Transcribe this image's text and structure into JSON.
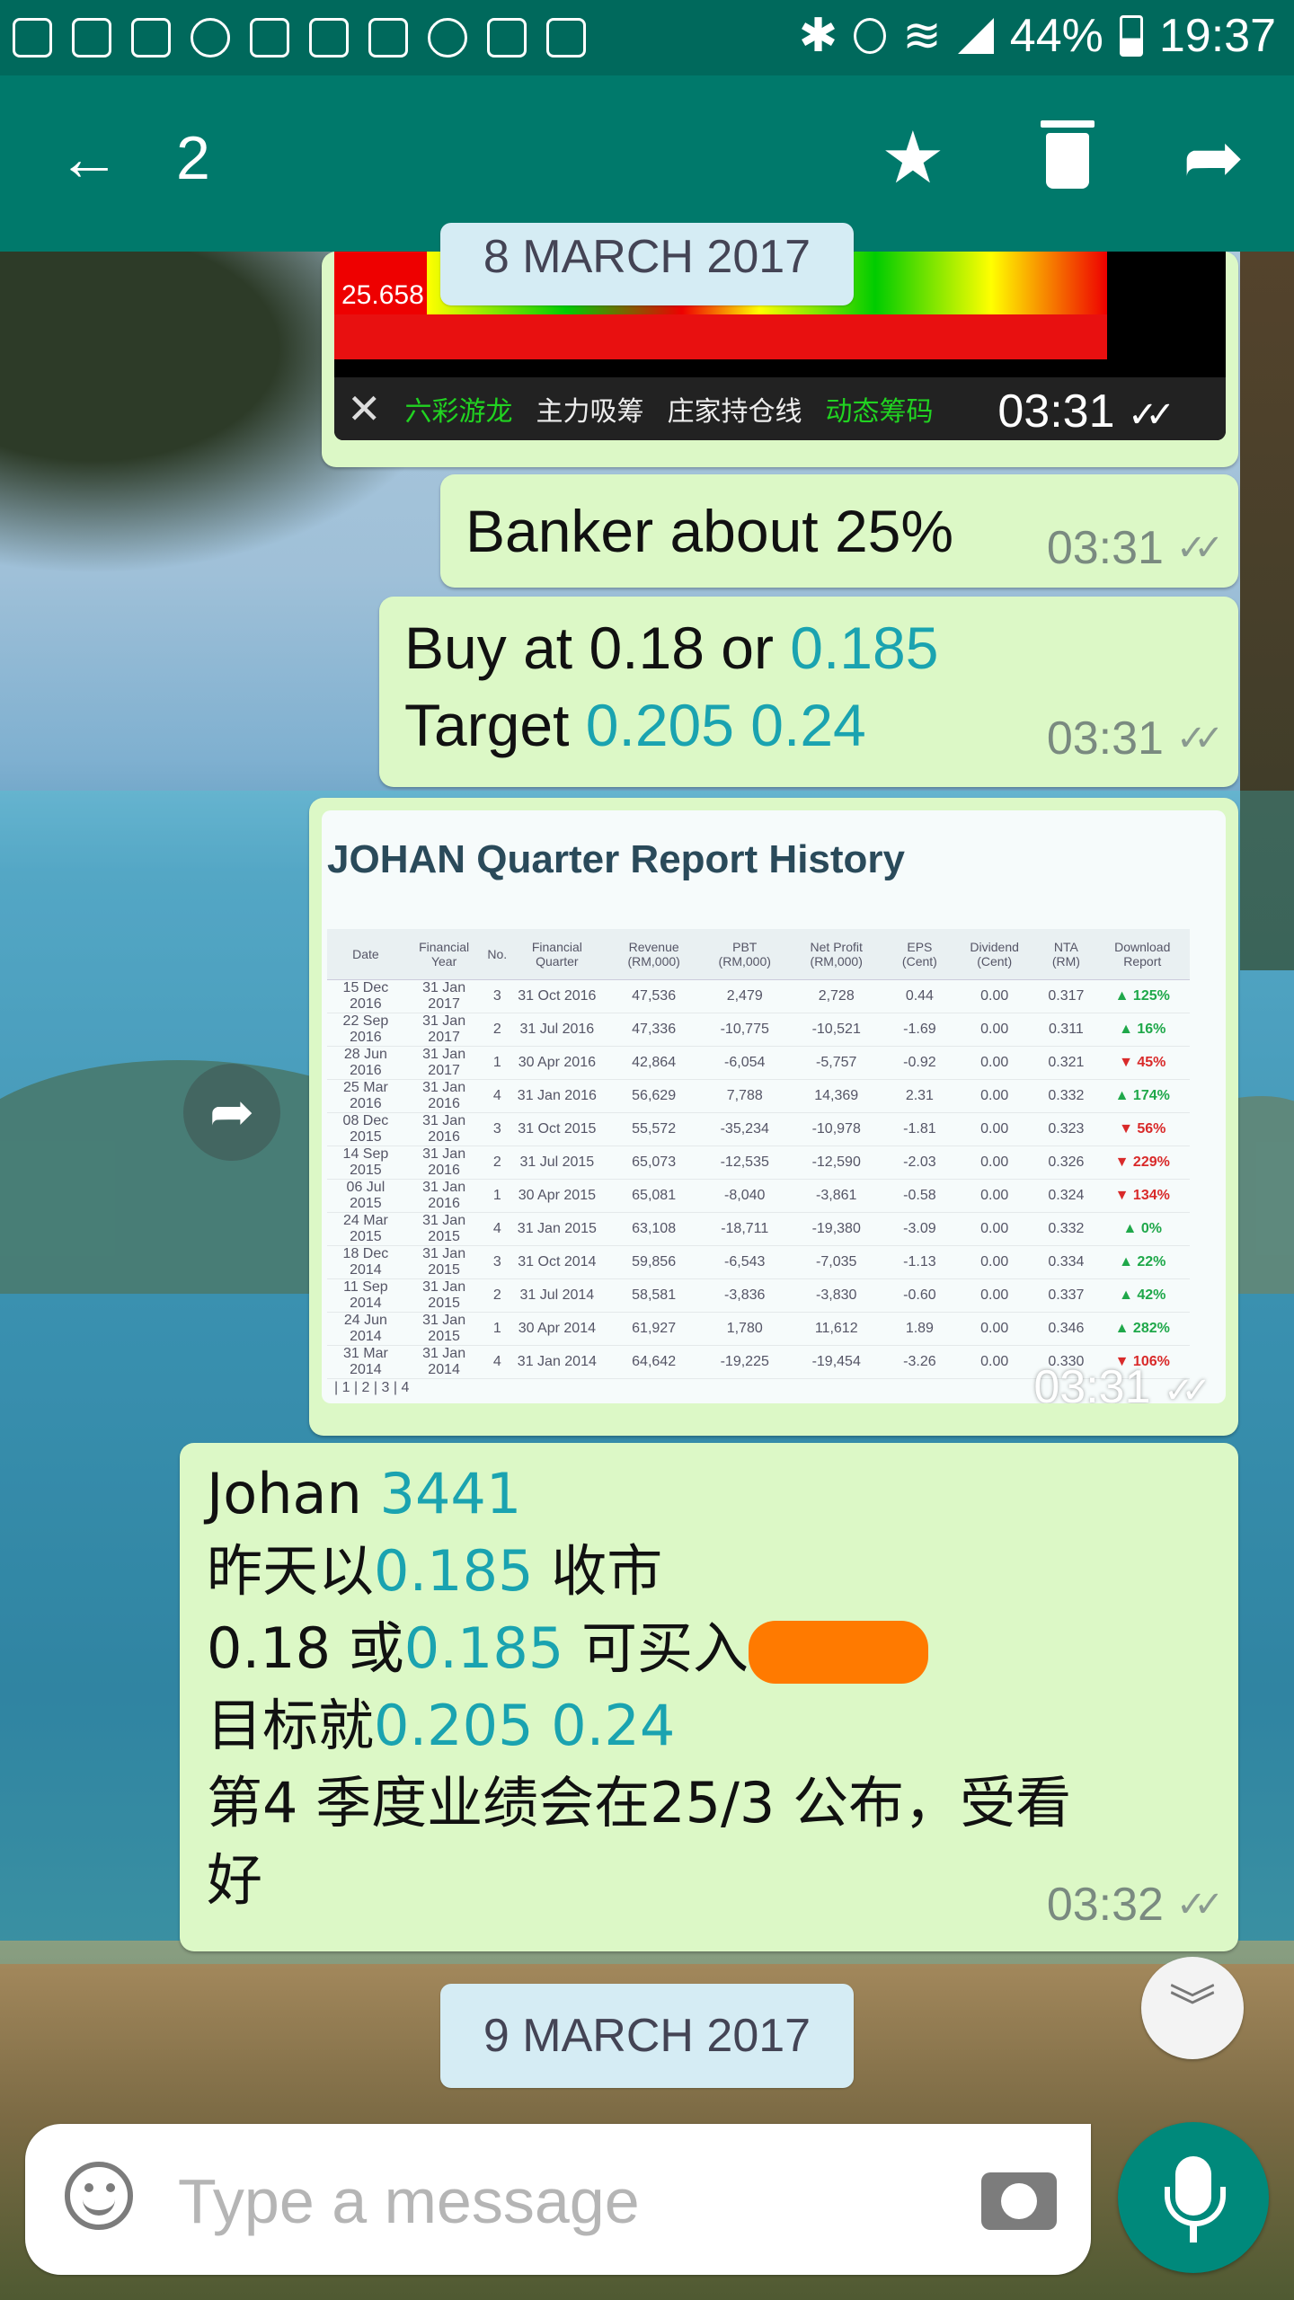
{
  "status_bar": {
    "battery": "44%",
    "time": "19:37"
  },
  "app_bar": {
    "selected_count": "2"
  },
  "chart_message": {
    "date_overlay": "8 MARCH 2017",
    "value": "25.658",
    "toolbar_items": [
      "六彩游龙",
      "主力吸筹",
      "庄家持仓线",
      "动态筹码"
    ],
    "time": "03:31"
  },
  "msg_banker": {
    "text": "Banker about 25%",
    "time": "03:31"
  },
  "msg_buy": {
    "line1_prefix": "Buy at 0.18 or ",
    "line1_value": "0.185",
    "line2_prefix": "Target ",
    "line2_value": "0.205 0.24",
    "time": "03:31"
  },
  "report_image": {
    "title": "JOHAN Quarter Report History",
    "columns": [
      "Date",
      "Financial Year",
      "No.",
      "Financial Quarter",
      "Revenue (RM,000)",
      "PBT (RM,000)",
      "Net Profit (RM,000)",
      "EPS (Cent)",
      "Dividend (Cent)",
      "NTA (RM)",
      "Download Report"
    ],
    "rows": [
      [
        "15 Dec 2016",
        "31 Jan 2017",
        "3",
        "31 Oct 2016",
        "47,536",
        "2,479",
        "2,728",
        "0.44",
        "0.00",
        "0.317",
        "125%",
        "up"
      ],
      [
        "22 Sep 2016",
        "31 Jan 2017",
        "2",
        "31 Jul 2016",
        "47,336",
        "-10,775",
        "-10,521",
        "-1.69",
        "0.00",
        "0.311",
        "16%",
        "up"
      ],
      [
        "28 Jun 2016",
        "31 Jan 2017",
        "1",
        "30 Apr 2016",
        "42,864",
        "-6,054",
        "-5,757",
        "-0.92",
        "0.00",
        "0.321",
        "45%",
        "down"
      ],
      [
        "25 Mar 2016",
        "31 Jan 2016",
        "4",
        "31 Jan 2016",
        "56,629",
        "7,788",
        "14,369",
        "2.31",
        "0.00",
        "0.332",
        "174%",
        "up"
      ],
      [
        "08 Dec 2015",
        "31 Jan 2016",
        "3",
        "31 Oct 2015",
        "55,572",
        "-35,234",
        "-10,978",
        "-1.81",
        "0.00",
        "0.323",
        "56%",
        "down"
      ],
      [
        "14 Sep 2015",
        "31 Jan 2016",
        "2",
        "31 Jul 2015",
        "65,073",
        "-12,535",
        "-12,590",
        "-2.03",
        "0.00",
        "0.326",
        "229%",
        "down"
      ],
      [
        "06 Jul 2015",
        "31 Jan 2016",
        "1",
        "30 Apr 2015",
        "65,081",
        "-8,040",
        "-3,861",
        "-0.58",
        "0.00",
        "0.324",
        "134%",
        "down"
      ],
      [
        "24 Mar 2015",
        "31 Jan 2015",
        "4",
        "31 Jan 2015",
        "63,108",
        "-18,711",
        "-19,380",
        "-3.09",
        "0.00",
        "0.332",
        "0%",
        "up"
      ],
      [
        "18 Dec 2014",
        "31 Jan 2015",
        "3",
        "31 Oct 2014",
        "59,856",
        "-6,543",
        "-7,035",
        "-1.13",
        "0.00",
        "0.334",
        "22%",
        "up"
      ],
      [
        "11 Sep 2014",
        "31 Jan 2015",
        "2",
        "31 Jul 2014",
        "58,581",
        "-3,836",
        "-3,830",
        "-0.60",
        "0.00",
        "0.337",
        "42%",
        "up"
      ],
      [
        "24 Jun 2014",
        "31 Jan 2015",
        "1",
        "30 Apr 2014",
        "61,927",
        "1,780",
        "11,612",
        "1.89",
        "0.00",
        "0.346",
        "282%",
        "up"
      ],
      [
        "31 Mar 2014",
        "31 Jan 2014",
        "4",
        "31 Jan 2014",
        "64,642",
        "-19,225",
        "-19,454",
        "-3.26",
        "0.00",
        "0.330",
        "106%",
        "down"
      ]
    ],
    "pager": "| 1 | 2 | 3 | 4",
    "time": "03:31"
  },
  "msg_chinese": {
    "l1_prefix": "Johan ",
    "l1_value": "3441",
    "l2_prefix": "昨天以",
    "l2_value": "0.185",
    "l2_suffix": " 收市",
    "l3_prefix": "0.18 或",
    "l3_value": "0.185",
    "l3_suffix": " 可买入",
    "l4_prefix": "目标就",
    "l4_value": "0.205 0.24",
    "l5": "第4 季度业绩会在25/3 公布，受看",
    "l6": "好",
    "time": "03:32"
  },
  "date_chip": "9 MARCH 2017",
  "composer": {
    "placeholder": "Type a message"
  },
  "colors": {
    "appbar": "#00796b",
    "statusbar": "#00695c",
    "outgoing_bubble": "#dcf8c6",
    "link_teal": "#1aa3b0",
    "selection": "#3cd2dc"
  },
  "icons": [
    "back-arrow-icon",
    "star-icon",
    "trash-icon",
    "forward-icon",
    "emoji-icon",
    "camera-icon",
    "mic-icon",
    "chevron-double-down-icon",
    "double-check-icon"
  ]
}
